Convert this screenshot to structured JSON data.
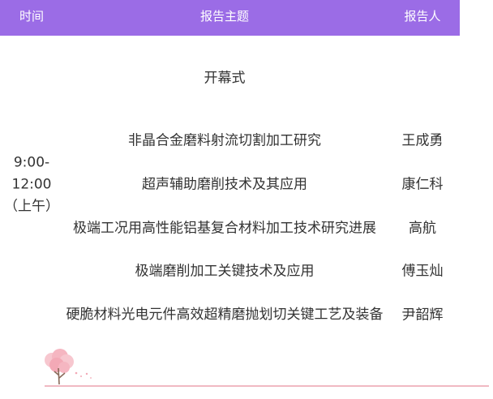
{
  "header": {
    "time_label": "时间",
    "topic_label": "报告主题",
    "speaker_label": "报告人"
  },
  "opening": "开幕式",
  "session": {
    "time_line1": "9:00-",
    "time_line2": "12:00",
    "time_line3": "（上午）"
  },
  "talks": [
    {
      "topic": "非晶合金磨料射流切割加工研究",
      "speaker": "王成勇"
    },
    {
      "topic": "超声辅助磨削技术及其应用",
      "speaker": "康仁科"
    },
    {
      "topic": "极端工况用高性能铝基复合材料加工技术研究进展",
      "speaker": "高航"
    },
    {
      "topic": "极端磨削加工关键技术及应用",
      "speaker": "傅玉灿"
    },
    {
      "topic": "硬脆材料光电元件高效超精磨抛划切关键工艺及装备",
      "speaker": "尹韶辉"
    }
  ],
  "colors": {
    "header_bg": "#9b6ce6",
    "header_text": "#ffffff",
    "body_text": "#333333",
    "accent_line": "#f0b9c3"
  },
  "icons": {
    "decor": "cherry-blossom-tree-icon"
  }
}
